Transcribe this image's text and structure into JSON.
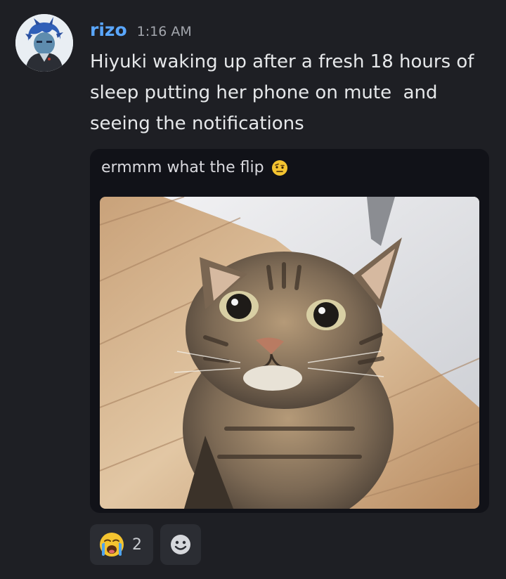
{
  "message": {
    "username": "rizo",
    "timestamp": "1:16 AM",
    "content": "Hiyuki waking up after a fresh 18 hours of sleep putting her phone on mute  and seeing the notifications",
    "colors": {
      "username": "#5aa7ff",
      "background": "#1e1f24",
      "text": "#e6e8ea"
    }
  },
  "attachment": {
    "caption": "ermmm what the flip",
    "caption_icon": "raised-eyebrow-emoji"
  },
  "reactions": [
    {
      "icon": "loudly-crying-emoji",
      "count": "2"
    }
  ],
  "add_reaction_icon": "smiley-add-reaction-icon"
}
